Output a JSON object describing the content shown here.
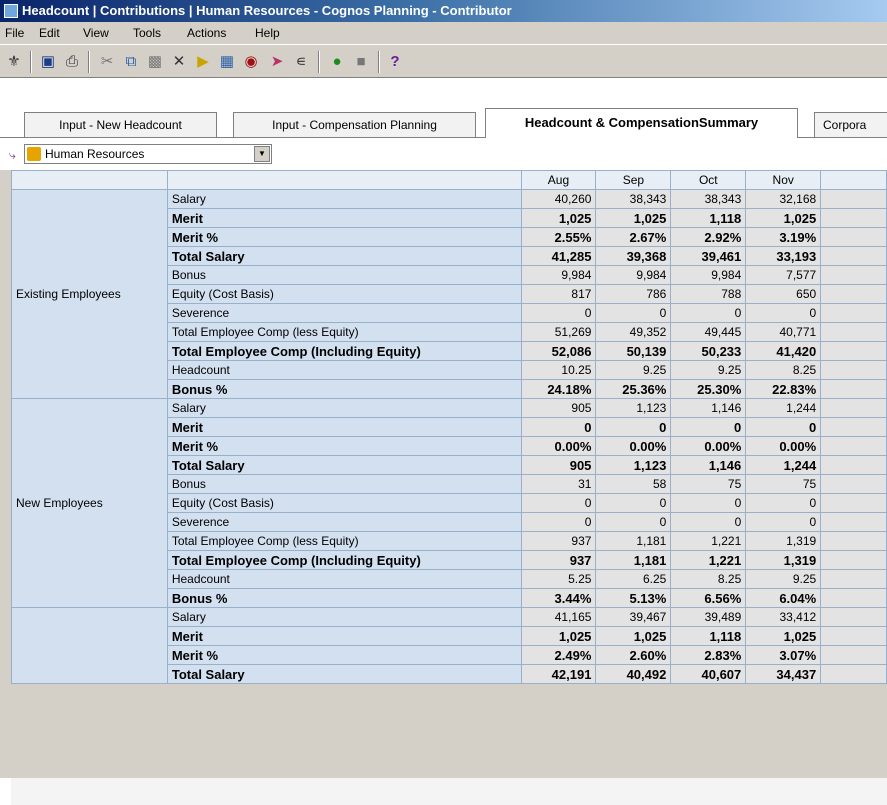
{
  "window": {
    "title": "Headcount | Contributions | Human Resources - Cognos Planning - Contributor"
  },
  "menu": [
    "File",
    "Edit",
    "View",
    "Tools",
    "Actions",
    "Help"
  ],
  "toolbar": [
    "exit-icon",
    "save-icon",
    "print-icon",
    "cut-icon",
    "copy-icon",
    "paste-icon",
    "delete-icon",
    "import-icon",
    "options-icon",
    "validate-icon",
    "submit-icon",
    "filter-icon",
    "go-icon",
    "stop-icon",
    "help-icon"
  ],
  "tabs": [
    "Input - New Headcount",
    "Input - Compensation Planning",
    "Headcount & CompensationSummary",
    "Corpora"
  ],
  "selector": {
    "value": "Human Resources"
  },
  "columns": [
    "Aug",
    "Sep",
    "Oct",
    "Nov"
  ],
  "groups": [
    {
      "label": "Existing Employees",
      "rows": [
        {
          "label": "Salary",
          "bold": false,
          "values": [
            "40,260",
            "38,343",
            "38,343",
            "32,168"
          ]
        },
        {
          "label": "Merit",
          "bold": true,
          "values": [
            "1,025",
            "1,025",
            "1,118",
            "1,025"
          ]
        },
        {
          "label": "Merit %",
          "bold": true,
          "values": [
            "2.55%",
            "2.67%",
            "2.92%",
            "3.19%"
          ]
        },
        {
          "label": "Total Salary",
          "bold": true,
          "values": [
            "41,285",
            "39,368",
            "39,461",
            "33,193"
          ]
        },
        {
          "label": "Bonus",
          "bold": false,
          "values": [
            "9,984",
            "9,984",
            "9,984",
            "7,577"
          ]
        },
        {
          "label": "Equity (Cost Basis)",
          "bold": false,
          "values": [
            "817",
            "786",
            "788",
            "650"
          ]
        },
        {
          "label": "Severence",
          "bold": false,
          "values": [
            "0",
            "0",
            "0",
            "0"
          ]
        },
        {
          "label": "Total Employee Comp (less Equity)",
          "bold": false,
          "values": [
            "51,269",
            "49,352",
            "49,445",
            "40,771"
          ]
        },
        {
          "label": "Total Employee Comp (Including Equity)",
          "bold": true,
          "values": [
            "52,086",
            "50,139",
            "50,233",
            "41,420"
          ]
        },
        {
          "label": "Headcount",
          "bold": false,
          "values": [
            "10.25",
            "9.25",
            "9.25",
            "8.25"
          ]
        },
        {
          "label": "Bonus %",
          "bold": true,
          "values": [
            "24.18%",
            "25.36%",
            "25.30%",
            "22.83%"
          ]
        }
      ]
    },
    {
      "label": "New Employees",
      "rows": [
        {
          "label": "Salary",
          "bold": false,
          "values": [
            "905",
            "1,123",
            "1,146",
            "1,244"
          ]
        },
        {
          "label": "Merit",
          "bold": true,
          "values": [
            "0",
            "0",
            "0",
            "0"
          ]
        },
        {
          "label": "Merit %",
          "bold": true,
          "values": [
            "0.00%",
            "0.00%",
            "0.00%",
            "0.00%"
          ]
        },
        {
          "label": "Total Salary",
          "bold": true,
          "values": [
            "905",
            "1,123",
            "1,146",
            "1,244"
          ]
        },
        {
          "label": "Bonus",
          "bold": false,
          "values": [
            "31",
            "58",
            "75",
            "75"
          ]
        },
        {
          "label": "Equity (Cost Basis)",
          "bold": false,
          "values": [
            "0",
            "0",
            "0",
            "0"
          ]
        },
        {
          "label": "Severence",
          "bold": false,
          "values": [
            "0",
            "0",
            "0",
            "0"
          ]
        },
        {
          "label": "Total Employee Comp (less Equity)",
          "bold": false,
          "values": [
            "937",
            "1,181",
            "1,221",
            "1,319"
          ]
        },
        {
          "label": "Total Employee Comp (Including Equity)",
          "bold": true,
          "values": [
            "937",
            "1,181",
            "1,221",
            "1,319"
          ]
        },
        {
          "label": "Headcount",
          "bold": false,
          "values": [
            "5.25",
            "6.25",
            "8.25",
            "9.25"
          ]
        },
        {
          "label": "Bonus %",
          "bold": true,
          "values": [
            "3.44%",
            "5.13%",
            "6.56%",
            "6.04%"
          ]
        }
      ]
    },
    {
      "label": "",
      "rows": [
        {
          "label": "Salary",
          "bold": false,
          "values": [
            "41,165",
            "39,467",
            "39,489",
            "33,412"
          ]
        },
        {
          "label": "Merit",
          "bold": true,
          "values": [
            "1,025",
            "1,025",
            "1,118",
            "1,025"
          ]
        },
        {
          "label": "Merit %",
          "bold": true,
          "values": [
            "2.49%",
            "2.60%",
            "2.83%",
            "3.07%"
          ]
        },
        {
          "label": "Total Salary",
          "bold": true,
          "values": [
            "42,191",
            "40,492",
            "40,607",
            "34,437"
          ]
        }
      ]
    }
  ]
}
